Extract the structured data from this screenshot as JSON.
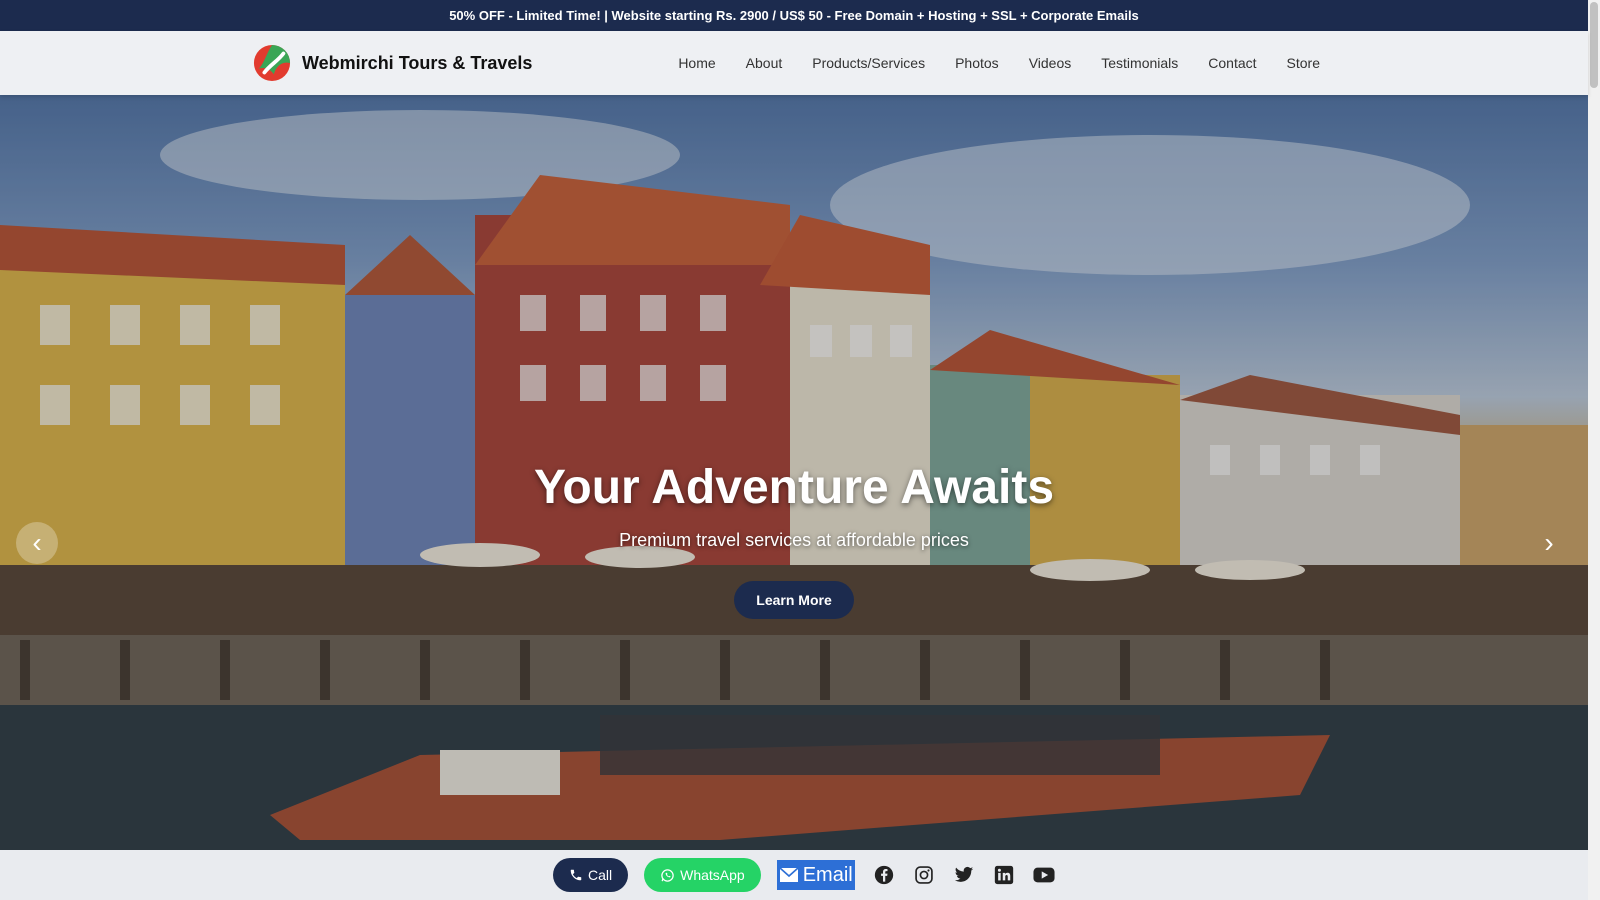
{
  "promo": {
    "text": "50% OFF - Limited Time! | Website starting Rs. 2900 / US$ 50 - Free Domain + Hosting + SSL + Corporate Emails"
  },
  "brand": {
    "name": "Webmirchi Tours & Travels",
    "logo_icon": "chili-logo-icon",
    "colors": {
      "red": "#e23b2e",
      "green": "#3aa655"
    }
  },
  "nav": {
    "items": [
      "Home",
      "About",
      "Products/Services",
      "Photos",
      "Videos",
      "Testimonials",
      "Contact",
      "Store"
    ]
  },
  "hero": {
    "title": "Your Adventure Awaits",
    "subtitle": "Premium travel services at affordable prices",
    "cta": "Learn More",
    "prev_symbol": "‹",
    "next_symbol": "›"
  },
  "footer": {
    "call": "Call",
    "whatsapp": "WhatsApp",
    "email": "Email",
    "social_icons": [
      "facebook-icon",
      "instagram-icon",
      "twitter-icon",
      "linkedin-icon",
      "youtube-icon"
    ]
  },
  "theme": {
    "primary": "#1c2b4e",
    "whatsapp": "#25d366",
    "email_highlight": "#2d6fd6"
  }
}
